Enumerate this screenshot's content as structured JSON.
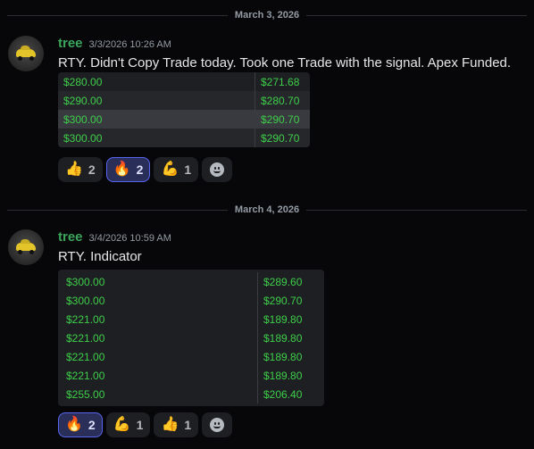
{
  "messages": [
    {
      "date_divider": "March 3, 2026",
      "username": "tree",
      "timestamp": "3/3/2026 10:26 AM",
      "text": "RTY. Didn't Copy Trade today. Took one Trade with the signal. Apex Funded.",
      "table": [
        [
          "$280.00",
          "$271.68"
        ],
        [
          "$290.00",
          "$280.70"
        ],
        [
          "$300.00",
          "$290.70"
        ],
        [
          "$300.00",
          "$290.70"
        ]
      ],
      "reactions": [
        {
          "emoji": "👍",
          "count": "2",
          "active": false
        },
        {
          "emoji": "🔥",
          "count": "2",
          "active": true
        },
        {
          "emoji": "💪",
          "count": "1",
          "active": false
        }
      ]
    },
    {
      "date_divider": "March 4, 2026",
      "username": "tree",
      "timestamp": "3/4/2026 10:59 AM",
      "text": "RTY. Indicator",
      "table": [
        [
          "$300.00",
          "$289.60"
        ],
        [
          "$300.00",
          "$290.70"
        ],
        [
          "$221.00",
          "$189.80"
        ],
        [
          "$221.00",
          "$189.80"
        ],
        [
          "$221.00",
          "$189.80"
        ],
        [
          "$221.00",
          "$189.80"
        ],
        [
          "$255.00",
          "$206.40"
        ]
      ],
      "reactions": [
        {
          "emoji": "🔥",
          "count": "2",
          "active": true
        },
        {
          "emoji": "💪",
          "count": "1",
          "active": false
        },
        {
          "emoji": "👍",
          "count": "1",
          "active": false
        }
      ]
    }
  ],
  "add_reaction_icon": "smiley-face-icon",
  "colors": {
    "background": "#070709",
    "username": "#3ba55c",
    "table_text": "#3ecf4a",
    "active_reaction_border": "#5865f2"
  }
}
